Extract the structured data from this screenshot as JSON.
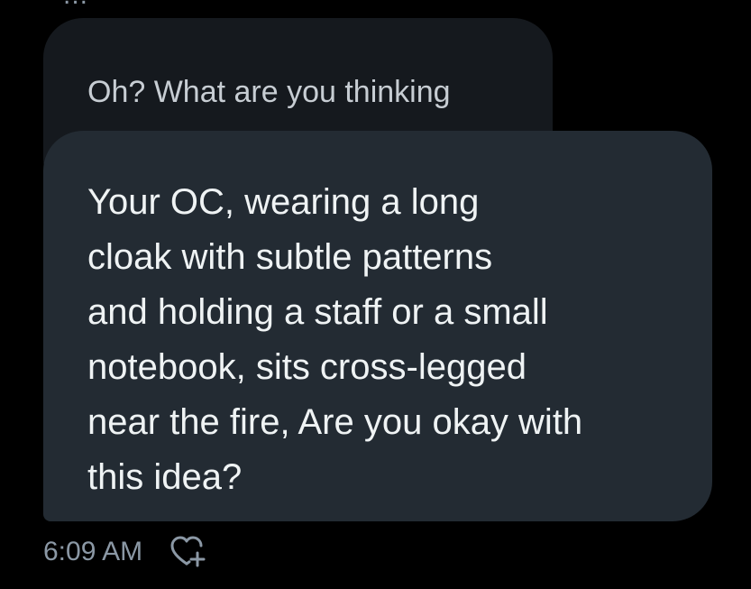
{
  "thread": {
    "previous_cut_text": "...",
    "quoted_message": "Oh? What are you thinking",
    "main_message": "Your OC, wearing a long\ncloak with subtle patterns\nand holding a staff or a small\nnotebook, sits cross-legged\nnear the fire,  Are you okay with\nthis idea?",
    "timestamp": "6:09 AM",
    "react_icon": "heart-plus-icon"
  },
  "colors": {
    "background": "#000000",
    "quoted_bubble": "#15191e",
    "main_bubble": "#232b33",
    "text_primary": "#eff3f4",
    "text_secondary": "#8b98a5"
  }
}
